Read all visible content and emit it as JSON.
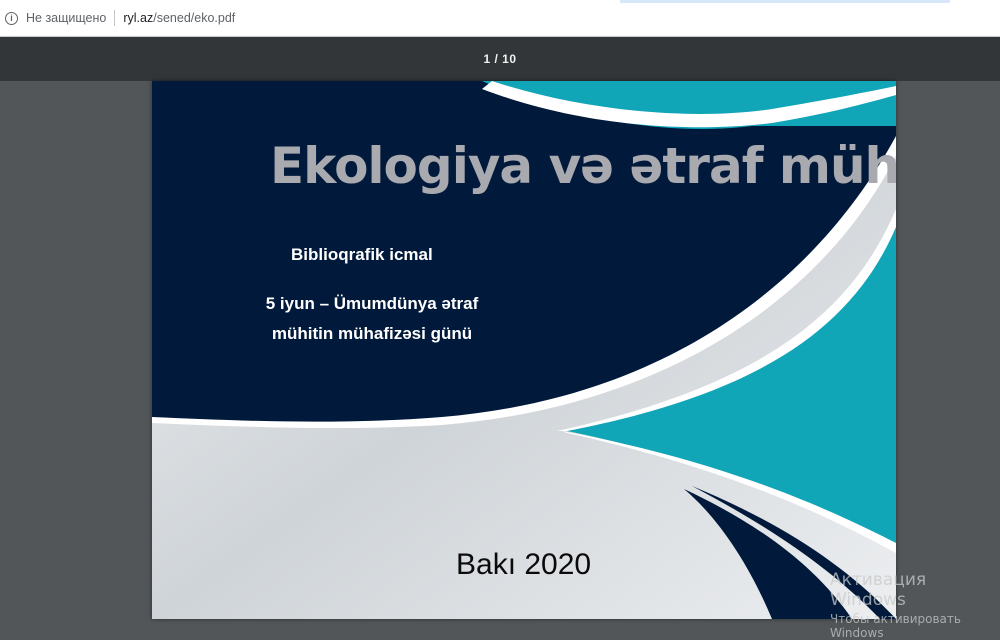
{
  "browser": {
    "security_label": "Не защищено",
    "url_host": "ryl.az",
    "url_path": "/sened/eko.pdf"
  },
  "pdf_toolbar": {
    "current_page": "1",
    "separator": "/",
    "total_pages": "10"
  },
  "document": {
    "title": "Ekologiya və ətraf mühit",
    "subtitle": "Biblioqrafik icmal",
    "occasion_line1": "5 iyun – Ümumdünya ətraf",
    "occasion_line2": "mühitin mühafizəsi günü",
    "place_year": "Bakı 2020",
    "colors": {
      "navy": "#01193a",
      "teal": "#11a5b8",
      "silver": "#d9dde1",
      "title_gray": "#a9aab0"
    }
  },
  "watermark": {
    "line1": "Активация Windows",
    "line2": "Чтобы активировать Windows"
  }
}
